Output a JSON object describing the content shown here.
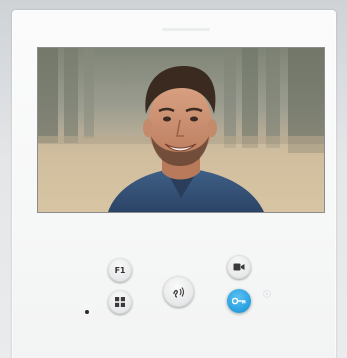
{
  "device": {
    "screen": {
      "content": "camera-feed"
    },
    "buttons": {
      "f1": {
        "label": "F1",
        "icon": "f1-text"
      },
      "grid": {
        "icon": "grid-icon"
      },
      "talk": {
        "icon": "talk-icon"
      },
      "camera": {
        "icon": "video-camera-icon"
      },
      "door": {
        "icon": "key-icon",
        "color": "#2ea4e3"
      }
    },
    "indicator": {
      "icon": "status-led"
    },
    "colors": {
      "body": "#f7f7f7",
      "accent_blue": "#2ea4e3",
      "screen_border": "#8c8c8c"
    }
  }
}
